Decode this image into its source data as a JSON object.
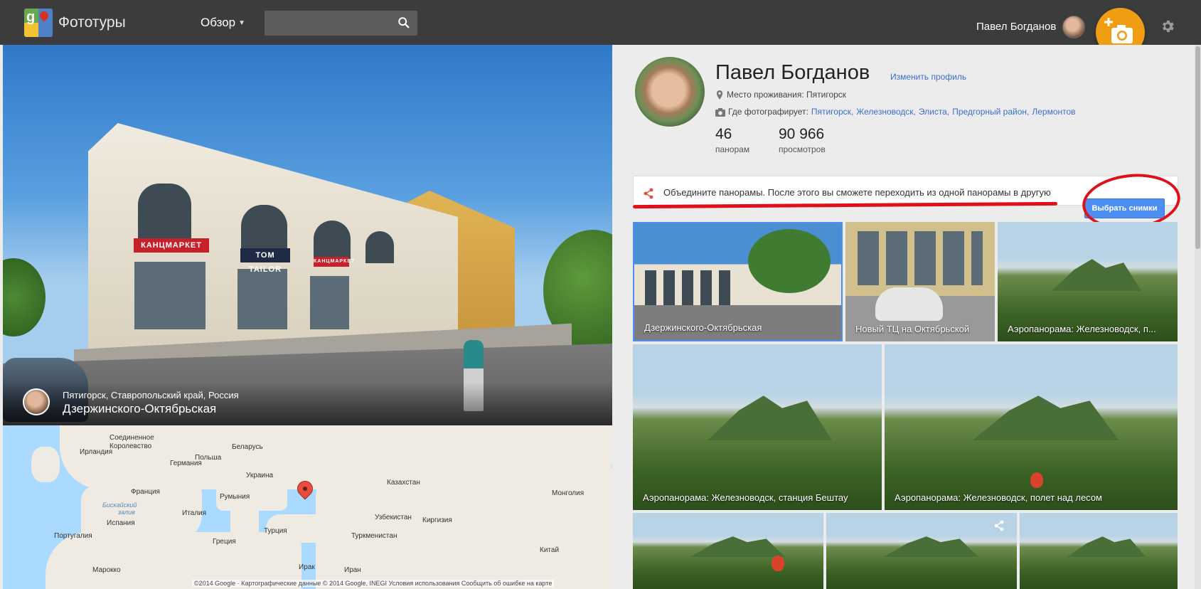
{
  "header": {
    "app_title": "Фототуры",
    "browse_label": "Обзор",
    "search_placeholder": "",
    "user_name": "Павел Богданов"
  },
  "panorama": {
    "location": "Пятигорск, Ставропольский край, Россия",
    "title": "Дзержинского-Октябрьская",
    "signs": [
      "КАНЦМАРКЕТ",
      "TOM TAILOR",
      "КАНЦМАРКЕТ"
    ]
  },
  "map": {
    "labels": [
      "Соединенное",
      "Королевство",
      "Ирландия",
      "Германия",
      "Беларусь",
      "Польша",
      "Франция",
      "Украина",
      "Бискайский",
      "залив",
      "Италия",
      "Румыния",
      "Казахстан",
      "Монголия",
      "Испания",
      "Турция",
      "Узбекистан",
      "Киргизия",
      "Португалия",
      "Туркменистан",
      "Греция",
      "Марокко",
      "Ирак",
      "Иран",
      "Китай"
    ],
    "attribution": "©2014 Google · Картографические данные © 2014 Google, INEGI     Условия использования     Сообщить об ошибке на карте"
  },
  "profile": {
    "name": "Павел Богданов",
    "edit_label": "Изменить профиль",
    "residence": "Место проживания: Пятигорск",
    "photographs_label": "Где фотографирует:",
    "places": [
      "Пятигорск,",
      "Железноводск,",
      "Элиста,",
      "Предгорный район,",
      "Лермонтов"
    ],
    "stats": [
      {
        "value": "46",
        "label": "панорам"
      },
      {
        "value": "90 966",
        "label": "просмотров"
      }
    ]
  },
  "banner": {
    "text": "Объедините панорамы. После этого вы сможете переходить из одной панорамы в другую",
    "button_label": "Выбрать снимки"
  },
  "thumbnails": [
    "Дзержинского-Октябрьская",
    "Новый ТЦ на Октябрьской",
    "Аэропанорама: Железноводск, п...",
    "Аэропанорама: Железноводск, станция Бештау",
    "Аэропанорама: Железноводск, полет над лесом",
    "",
    "",
    ""
  ],
  "colors": {
    "topbar": "#3c3c3c",
    "accent_orange": "#f09d13",
    "link_blue": "#3a6fd1",
    "button_blue": "#4d8ff0",
    "annotation_red": "#e0101a"
  },
  "icons": [
    "search-icon",
    "camera-add-icon",
    "gear-icon",
    "location-pin-icon",
    "camera-icon",
    "share-icon",
    "map-pin-icon"
  ]
}
